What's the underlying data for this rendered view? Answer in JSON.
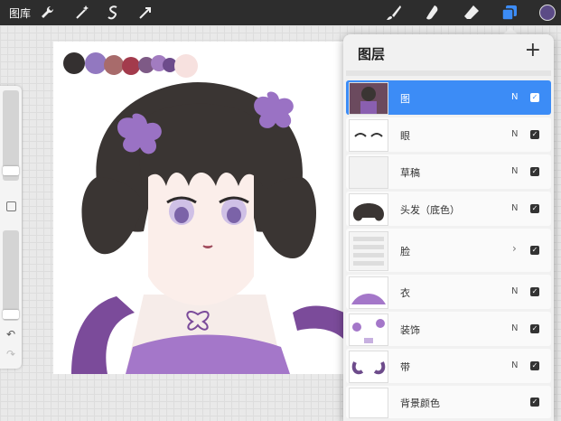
{
  "topbar": {
    "gallery_label": "图库",
    "left_tools": [
      "wrench-icon",
      "magic-wand-icon",
      "selection-icon",
      "transform-arrow-icon"
    ],
    "right_tools": [
      "brush-icon",
      "smudge-icon",
      "eraser-icon",
      "layers-icon",
      "color-swatch-icon"
    ],
    "active_color": "#5b4b86",
    "accent": "#3c8cf6"
  },
  "canvas": {
    "palette": [
      "#343030",
      "#9278c0",
      "#a86b6b",
      "#a33b4c",
      "#7e5a86",
      "#a27cc0",
      "#6d4b8b",
      "#f7e1df"
    ]
  },
  "sidebar": {
    "brush_size": 0.2,
    "opacity": 0.1
  },
  "layers": {
    "title": "图层",
    "add_label": "+",
    "items": [
      {
        "name": "图",
        "blend": "N",
        "visible": true,
        "selected": true
      },
      {
        "name": "眼",
        "blend": "N",
        "visible": true
      },
      {
        "name": "草稿",
        "blend": "N",
        "visible": true
      },
      {
        "name": "头发（底色）",
        "blend": "N",
        "visible": true
      },
      {
        "name": "脸",
        "blend": "",
        "visible": true,
        "group": true,
        "chevron": "›"
      },
      {
        "name": "衣",
        "blend": "N",
        "visible": true
      },
      {
        "name": "装饰",
        "blend": "N",
        "visible": true
      },
      {
        "name": "带",
        "blend": "N",
        "visible": true
      },
      {
        "name": "背景颜色",
        "blend": "",
        "visible": true
      }
    ]
  }
}
